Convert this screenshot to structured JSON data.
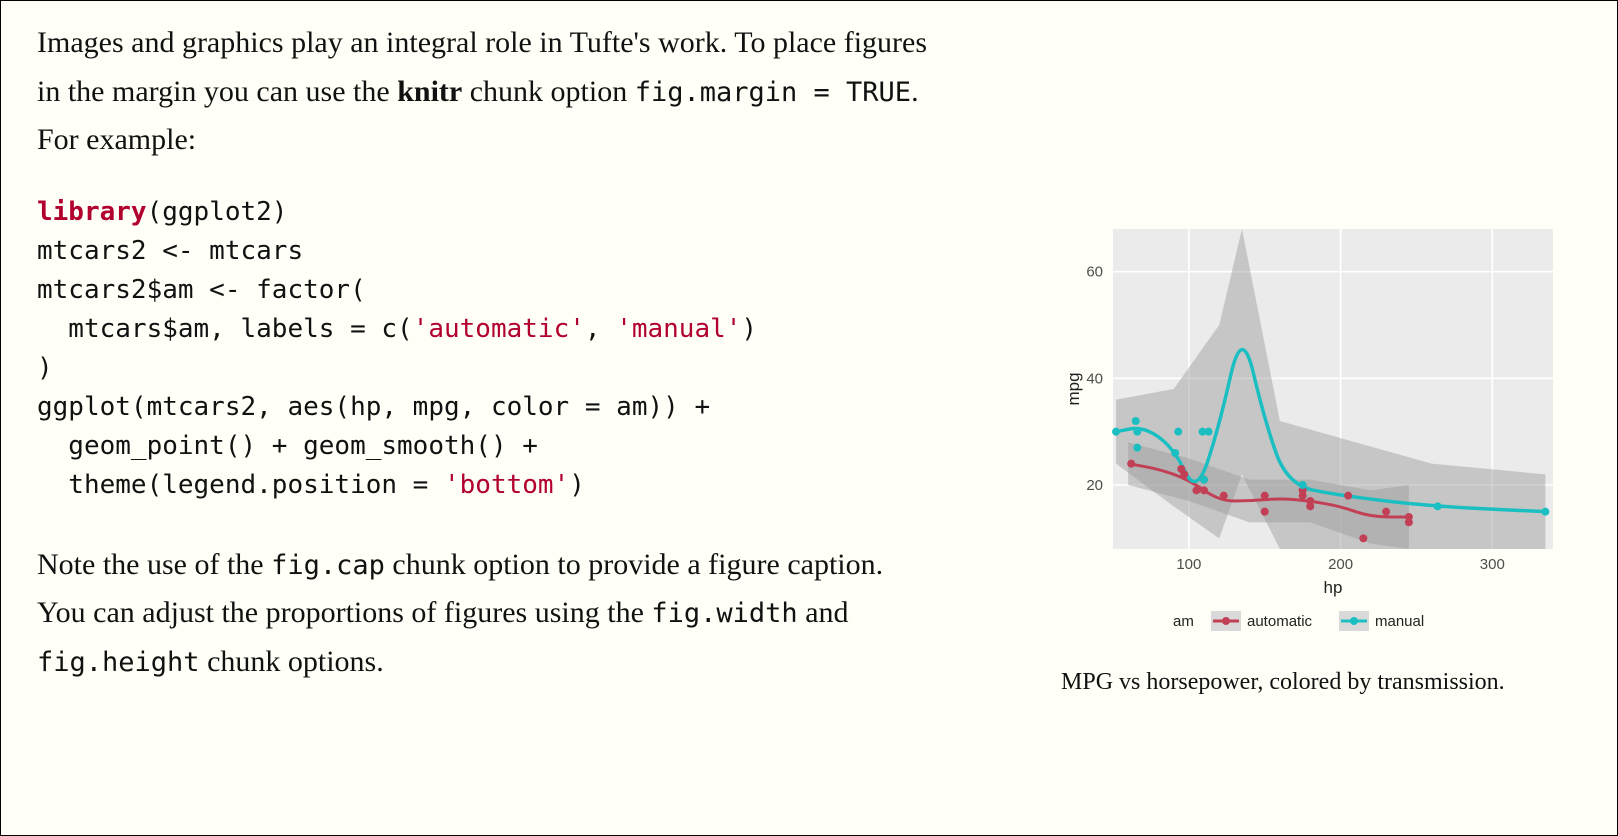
{
  "para1": {
    "t1": "Images and graphics play an integral role in Tufte's work. To place figures in the margin you can use the ",
    "strong": "knitr",
    "t2": " chunk option ",
    "code": "fig.margin = TRUE",
    "t3": ". For example:"
  },
  "code": {
    "l1_kw": "library",
    "l1_rest": "(ggplot2)",
    "l2": "mtcars2 <- mtcars",
    "l3": "mtcars2$am <- factor(",
    "l4_a": "  mtcars$am, labels = c(",
    "l4_s1": "'automatic'",
    "l4_b": ", ",
    "l4_s2": "'manual'",
    "l4_c": ")",
    "l5": ")",
    "l6": "ggplot(mtcars2, aes(hp, mpg, color = am)) +",
    "l7": "  geom_point() + geom_smooth() +",
    "l8_a": "  theme(legend.position = ",
    "l8_s": "'bottom'",
    "l8_b": ")"
  },
  "para2": {
    "t1": "Note the use of the ",
    "c1": "fig.cap",
    "t2": " chunk option to provide a figure caption. You can adjust the proportions of figures using the ",
    "c2": "fig.width",
    "t3": " and ",
    "c3": "fig.height",
    "t4": " chunk options."
  },
  "figure_caption": "MPG vs horsepower, colored by transmission.",
  "chart_data": {
    "type": "scatter+smooth",
    "xlabel": "hp",
    "ylabel": "mpg",
    "xlim": [
      50,
      340
    ],
    "ylim": [
      8,
      68
    ],
    "x_ticks": [
      100,
      200,
      300
    ],
    "y_ticks": [
      20,
      40,
      60
    ],
    "legend_title": "am",
    "series": [
      {
        "name": "automatic",
        "color": "#c24055",
        "points": [
          {
            "x": 105,
            "y": 19
          },
          {
            "x": 110,
            "y": 21
          },
          {
            "x": 110,
            "y": 19
          },
          {
            "x": 123,
            "y": 18
          },
          {
            "x": 150,
            "y": 15
          },
          {
            "x": 150,
            "y": 18
          },
          {
            "x": 175,
            "y": 19
          },
          {
            "x": 175,
            "y": 18
          },
          {
            "x": 180,
            "y": 17
          },
          {
            "x": 180,
            "y": 16
          },
          {
            "x": 205,
            "y": 18
          },
          {
            "x": 215,
            "y": 10
          },
          {
            "x": 230,
            "y": 15
          },
          {
            "x": 245,
            "y": 13
          },
          {
            "x": 245,
            "y": 14
          },
          {
            "x": 62,
            "y": 24
          },
          {
            "x": 95,
            "y": 23
          },
          {
            "x": 97,
            "y": 22
          },
          {
            "x": 150,
            "y": 15
          }
        ],
        "smooth": [
          {
            "x": 60,
            "y": 24
          },
          {
            "x": 80,
            "y": 23
          },
          {
            "x": 100,
            "y": 21
          },
          {
            "x": 120,
            "y": 17
          },
          {
            "x": 140,
            "y": 17
          },
          {
            "x": 160,
            "y": 17.5
          },
          {
            "x": 180,
            "y": 17
          },
          {
            "x": 200,
            "y": 16
          },
          {
            "x": 220,
            "y": 14
          },
          {
            "x": 245,
            "y": 14
          }
        ],
        "ribbon_lo": [
          {
            "x": 60,
            "y": 20
          },
          {
            "x": 100,
            "y": 17
          },
          {
            "x": 140,
            "y": 13
          },
          {
            "x": 180,
            "y": 13
          },
          {
            "x": 220,
            "y": 9
          },
          {
            "x": 245,
            "y": 8
          }
        ],
        "ribbon_hi": [
          {
            "x": 60,
            "y": 28
          },
          {
            "x": 100,
            "y": 25
          },
          {
            "x": 140,
            "y": 21
          },
          {
            "x": 180,
            "y": 21
          },
          {
            "x": 220,
            "y": 19
          },
          {
            "x": 245,
            "y": 20
          }
        ]
      },
      {
        "name": "manual",
        "color": "#1bbfc1",
        "points": [
          {
            "x": 52,
            "y": 30
          },
          {
            "x": 65,
            "y": 32
          },
          {
            "x": 66,
            "y": 30
          },
          {
            "x": 66,
            "y": 27
          },
          {
            "x": 91,
            "y": 26
          },
          {
            "x": 93,
            "y": 30
          },
          {
            "x": 109,
            "y": 30
          },
          {
            "x": 110,
            "y": 21
          },
          {
            "x": 113,
            "y": 30
          },
          {
            "x": 175,
            "y": 20
          },
          {
            "x": 264,
            "y": 16
          },
          {
            "x": 335,
            "y": 15
          }
        ],
        "smooth": [
          {
            "x": 52,
            "y": 30
          },
          {
            "x": 70,
            "y": 31
          },
          {
            "x": 90,
            "y": 27
          },
          {
            "x": 105,
            "y": 18
          },
          {
            "x": 120,
            "y": 31
          },
          {
            "x": 135,
            "y": 50
          },
          {
            "x": 150,
            "y": 32
          },
          {
            "x": 165,
            "y": 20
          },
          {
            "x": 200,
            "y": 18
          },
          {
            "x": 260,
            "y": 16
          },
          {
            "x": 335,
            "y": 15
          }
        ],
        "ribbon_lo": [
          {
            "x": 52,
            "y": 24
          },
          {
            "x": 90,
            "y": 16
          },
          {
            "x": 120,
            "y": 10
          },
          {
            "x": 135,
            "y": 22
          },
          {
            "x": 160,
            "y": 8
          },
          {
            "x": 260,
            "y": 8
          },
          {
            "x": 335,
            "y": 8
          }
        ],
        "ribbon_hi": [
          {
            "x": 52,
            "y": 36
          },
          {
            "x": 90,
            "y": 38
          },
          {
            "x": 120,
            "y": 50
          },
          {
            "x": 135,
            "y": 68
          },
          {
            "x": 160,
            "y": 32
          },
          {
            "x": 260,
            "y": 24
          },
          {
            "x": 335,
            "y": 22
          }
        ]
      }
    ]
  }
}
